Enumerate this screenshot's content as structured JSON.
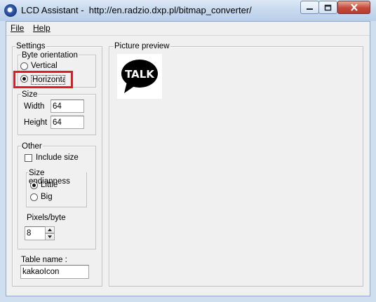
{
  "window": {
    "title": "LCD Assistant -  http://en.radzio.dxp.pl/bitmap_converter/",
    "minimize_icon": "minimize-icon",
    "maximize_icon": "maximize-icon",
    "close_icon": "close-icon"
  },
  "menu": {
    "file": "File",
    "help": "Help"
  },
  "settings": {
    "label": "Settings",
    "byte_orientation": {
      "label": "Byte orientation",
      "vertical": "Vertical",
      "horizontal": "Horizontal",
      "selected": "Horizontal"
    },
    "size": {
      "label": "Size",
      "width_label": "Width",
      "width_value": "64",
      "height_label": "Height",
      "height_value": "64"
    },
    "other": {
      "label": "Other",
      "include_size": "Include size",
      "include_size_checked": false,
      "size_endianness": {
        "label": "Size endianness",
        "little": "Little",
        "big": "Big",
        "selected": "Little"
      },
      "pixels_per_byte_label": "Pixels/byte",
      "pixels_per_byte_value": "8"
    },
    "table_name_label": "Table name :",
    "table_name_value": "kakaoIcon"
  },
  "preview": {
    "label": "Picture preview",
    "image_text": "TALK"
  },
  "colors": {
    "highlight": "#e01b24",
    "titlebar": "#c7d9ee",
    "close": "#c4493a"
  }
}
